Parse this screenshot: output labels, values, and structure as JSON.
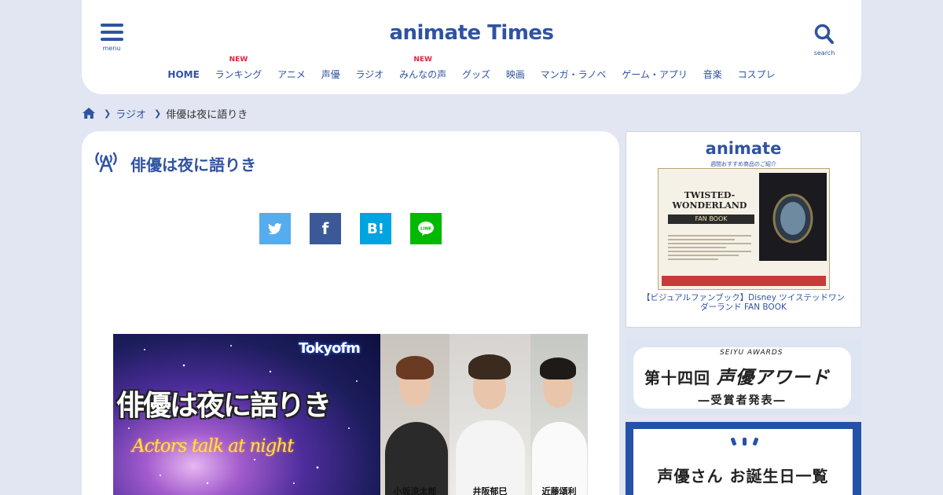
{
  "header": {
    "menu_label": "menu",
    "search_label": "search",
    "logo_text": "animate Times",
    "nav": [
      {
        "label": "HOME",
        "badge": ""
      },
      {
        "label": "ランキング",
        "badge": "NEW"
      },
      {
        "label": "アニメ",
        "badge": ""
      },
      {
        "label": "声優",
        "badge": ""
      },
      {
        "label": "ラジオ",
        "badge": ""
      },
      {
        "label": "みんなの声",
        "badge": "NEW"
      },
      {
        "label": "グッズ",
        "badge": ""
      },
      {
        "label": "映画",
        "badge": ""
      },
      {
        "label": "マンガ・ラノベ",
        "badge": ""
      },
      {
        "label": "ゲーム・アプリ",
        "badge": ""
      },
      {
        "label": "音楽",
        "badge": ""
      },
      {
        "label": "コスプレ",
        "badge": ""
      }
    ]
  },
  "breadcrumb": {
    "category": "ラジオ",
    "current": "俳優は夜に語りき"
  },
  "main": {
    "title": "俳優は夜に語りき",
    "share_hatena": "B!",
    "share_facebook": "f",
    "banner": {
      "station": "Tokyofm",
      "title": "俳優は夜に語りき",
      "subtitle": "Actors talk at night",
      "people": [
        "小坂涼太郎",
        "井阪郁巳",
        "近藤頌利"
      ]
    }
  },
  "sidebar": {
    "ad_logo": "animate",
    "ad_tagline": "週間おすすめ商品のご紹介",
    "book_title": "TWISTED-WONDERLAND",
    "book_band": "FAN BOOK",
    "ad_caption": "【ビジュアルファンブック】Disney ツイステッドワンダーランド FAN BOOK",
    "award_prefix": "第十四回",
    "award_name": "声優アワード",
    "award_en": "SEIYU AWARDS",
    "award_sub": "―受賞者発表―",
    "birthday_text": "声優さん お誕生日一覧"
  },
  "colors": {
    "brand": "#2f53a0",
    "new_badge": "#e0243f",
    "twitter": "#55acee",
    "facebook": "#3b5998",
    "hatena": "#00a4de",
    "line": "#00b900",
    "page_bg": "#e1e6f2"
  }
}
